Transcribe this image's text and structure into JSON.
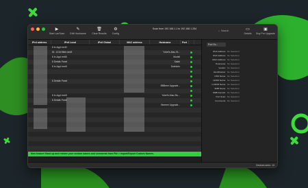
{
  "toolbar": {
    "buttons": [
      {
        "label": "Start LanScan",
        "icon": "play-icon"
      },
      {
        "label": "Edit Hostname",
        "icon": "pencil-icon"
      },
      {
        "label": "Clear Results",
        "icon": "trash-icon"
      },
      {
        "label": "Config",
        "icon": "gear-icon"
      }
    ],
    "scan_status": "Scan from 192.168.1.1 to 192.168.1.254",
    "search_placeholder": "Search",
    "right_buttons": [
      {
        "label": "Details",
        "icon": "sidebar-icon"
      },
      {
        "label": "Buy Pro Upgrade",
        "icon": "bag-icon"
      }
    ]
  },
  "columns": [
    "IPv4 address",
    "IPv6 Local",
    "IPv6 Global",
    "MAC address",
    "Hostname",
    "Port"
  ],
  "rows": [
    {
      "v6": "8 In-App! ee40",
      "host": "",
      "dot": false
    },
    {
      "v6": "81: 1218:96bb:de48",
      "host": "Yubel's-Mac-St...",
      "dot": true
    },
    {
      "v6": "8 In-App! ee68",
      "host": "Modell",
      "dot": true
    },
    {
      "v6": "8 Details Panel",
      "host": "Salah",
      "dot": true
    },
    {
      "v6": "8 In-App! eee8",
      "host": "Dutelorio",
      "dot": true
    },
    {
      "v6": "",
      "host": "",
      "dot": true
    },
    {
      "v6": "",
      "host": "",
      "dot": true
    },
    {
      "v6": "8 Details Panel",
      "host": "",
      "dot": true
    },
    {
      "v6": "",
      "host": "BBBeee Upgrade...",
      "dot": true
    },
    {
      "v6": "",
      "host": "",
      "dot": true
    },
    {
      "v6": "8 In-App! eee8",
      "host": "Yubel's-Mac-Stu...",
      "dot": true
    },
    {
      "v6": "8 Details Panel",
      "host": "",
      "dot": true
    },
    {
      "v6": "",
      "host": "Beeeee Upgrade...",
      "dot": true
    },
    {
      "v6": "",
      "host": "",
      "dot": false
    }
  ],
  "sidebar": {
    "port_scan_label": "Port Sc...",
    "properties": [
      {
        "key": "IPv4 Address:",
        "value": "No Selection"
      },
      {
        "key": "IPv6 Address:",
        "value": "No Selection"
      },
      {
        "key": "MAC Address:",
        "value": "No Selection"
      },
      {
        "key": "Hostname:",
        "value": "No Selection"
      },
      {
        "key": "Vendor:",
        "value": "No Selection"
      },
      {
        "key": "Identification:",
        "value": "No Selection"
      },
      {
        "key": "DNS Name:",
        "value": "No Selection"
      },
      {
        "key": "mDNS Name:",
        "value": "No Selection"
      },
      {
        "key": "LLMNR Name:",
        "value": "No Selection"
      },
      {
        "key": "SMB Name:",
        "value": "No Selection"
      },
      {
        "key": "SMB Domain:",
        "value": "No Selection"
      },
      {
        "key": "Port Scan:",
        "value": "No Selection"
      },
      {
        "key": "Comments:",
        "value": "No Selection"
      }
    ]
  },
  "banner": "New feature! Back up and restore your custom names and comments from File > Import/Export Custom Names.",
  "status": "Devices seen: 13",
  "colors": {
    "accent_green": "#2fd23d",
    "background": "#1c2529"
  }
}
